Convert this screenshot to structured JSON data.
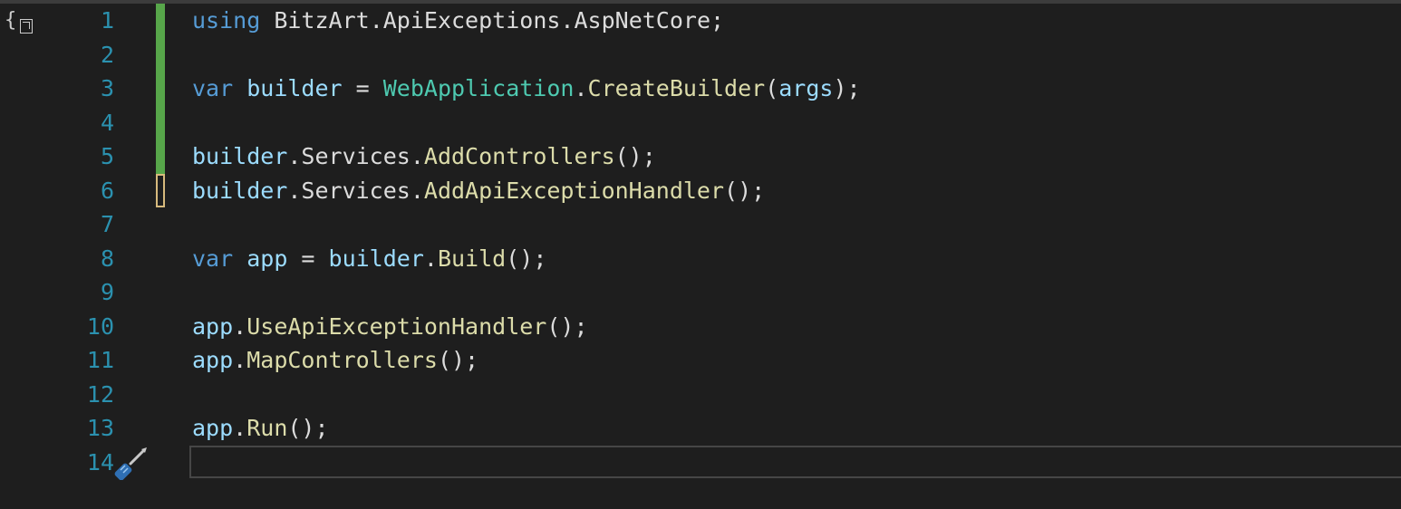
{
  "lines": [
    {
      "number": "1",
      "tokens": [
        {
          "text": "using",
          "kind": "kw"
        },
        {
          "text": " BitzArt",
          "kind": "ns"
        },
        {
          "text": ".",
          "kind": "punct"
        },
        {
          "text": "ApiExceptions",
          "kind": "ns"
        },
        {
          "text": ".",
          "kind": "punct"
        },
        {
          "text": "AspNetCore",
          "kind": "ns"
        },
        {
          "text": ";",
          "kind": "punct"
        }
      ]
    },
    {
      "number": "2",
      "tokens": []
    },
    {
      "number": "3",
      "tokens": [
        {
          "text": "var",
          "kind": "kw"
        },
        {
          "text": " ",
          "kind": "punct"
        },
        {
          "text": "builder",
          "kind": "var"
        },
        {
          "text": " = ",
          "kind": "punct"
        },
        {
          "text": "WebApplication",
          "kind": "type"
        },
        {
          "text": ".",
          "kind": "punct"
        },
        {
          "text": "CreateBuilder",
          "kind": "meth"
        },
        {
          "text": "(",
          "kind": "punct"
        },
        {
          "text": "args",
          "kind": "param"
        },
        {
          "text": ");",
          "kind": "punct"
        }
      ]
    },
    {
      "number": "4",
      "tokens": []
    },
    {
      "number": "5",
      "tokens": [
        {
          "text": "builder",
          "kind": "var"
        },
        {
          "text": ".",
          "kind": "punct"
        },
        {
          "text": "Services",
          "kind": "ns"
        },
        {
          "text": ".",
          "kind": "punct"
        },
        {
          "text": "AddControllers",
          "kind": "meth"
        },
        {
          "text": "();",
          "kind": "punct"
        }
      ]
    },
    {
      "number": "6",
      "tokens": [
        {
          "text": "builder",
          "kind": "var"
        },
        {
          "text": ".",
          "kind": "punct"
        },
        {
          "text": "Services",
          "kind": "ns"
        },
        {
          "text": ".",
          "kind": "punct"
        },
        {
          "text": "AddApiExceptionHandler",
          "kind": "meth"
        },
        {
          "text": "();",
          "kind": "punct"
        }
      ]
    },
    {
      "number": "7",
      "tokens": []
    },
    {
      "number": "8",
      "tokens": [
        {
          "text": "var",
          "kind": "kw"
        },
        {
          "text": " ",
          "kind": "punct"
        },
        {
          "text": "app",
          "kind": "var"
        },
        {
          "text": " = ",
          "kind": "punct"
        },
        {
          "text": "builder",
          "kind": "var"
        },
        {
          "text": ".",
          "kind": "punct"
        },
        {
          "text": "Build",
          "kind": "meth"
        },
        {
          "text": "();",
          "kind": "punct"
        }
      ]
    },
    {
      "number": "9",
      "tokens": []
    },
    {
      "number": "10",
      "tokens": [
        {
          "text": "app",
          "kind": "var"
        },
        {
          "text": ".",
          "kind": "punct"
        },
        {
          "text": "UseApiExceptionHandler",
          "kind": "meth"
        },
        {
          "text": "();",
          "kind": "punct"
        }
      ]
    },
    {
      "number": "11",
      "tokens": [
        {
          "text": "app",
          "kind": "var"
        },
        {
          "text": ".",
          "kind": "punct"
        },
        {
          "text": "MapControllers",
          "kind": "meth"
        },
        {
          "text": "();",
          "kind": "punct"
        }
      ]
    },
    {
      "number": "12",
      "tokens": []
    },
    {
      "number": "13",
      "tokens": [
        {
          "text": "app",
          "kind": "var"
        },
        {
          "text": ".",
          "kind": "punct"
        },
        {
          "text": "Run",
          "kind": "meth"
        },
        {
          "text": "();",
          "kind": "punct"
        }
      ]
    },
    {
      "number": "14",
      "tokens": []
    }
  ],
  "change_markers": {
    "saved": [
      "1",
      "2",
      "3",
      "4",
      "5"
    ],
    "unsaved": [
      "6"
    ]
  },
  "icons": {
    "scope": "scope-braces-icon",
    "quick_actions": "screwdriver-icon"
  },
  "colors": {
    "background": "#1e1e1e",
    "line_number": "#2b91af",
    "keyword": "#569cd6",
    "variable": "#9cdcfe",
    "type": "#4ec9b0",
    "method": "#dcdcaa",
    "text": "#dcdcdc",
    "change_saved": "#57a64a",
    "change_unsaved": "#d7ba7d"
  }
}
